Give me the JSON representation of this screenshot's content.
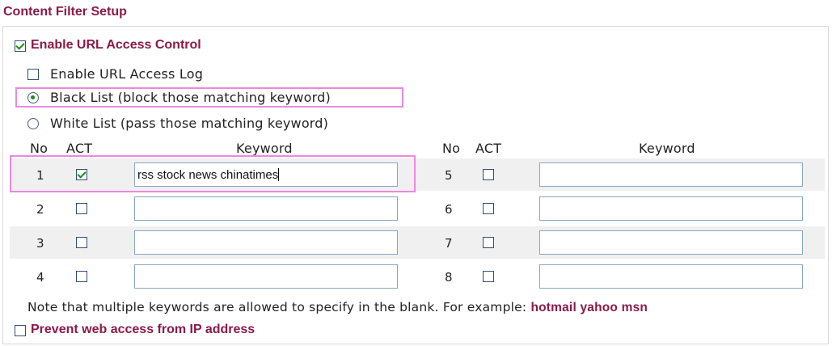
{
  "title": "Content Filter Setup",
  "enable_url_access_control": {
    "label": "Enable URL Access Control",
    "checked": true
  },
  "enable_url_access_log": {
    "label": "Enable URL Access Log",
    "checked": false
  },
  "list_mode": {
    "black": {
      "label": "Black List (block those matching keyword)",
      "selected": true
    },
    "white": {
      "label": "White List (pass those matching keyword)",
      "selected": false
    }
  },
  "headers": {
    "no": "No",
    "act": "ACT",
    "keyword": "Keyword"
  },
  "rows_left": [
    {
      "no": "1",
      "act": true,
      "keyword": "rss stock news chinatimes"
    },
    {
      "no": "2",
      "act": false,
      "keyword": ""
    },
    {
      "no": "3",
      "act": false,
      "keyword": ""
    },
    {
      "no": "4",
      "act": false,
      "keyword": ""
    }
  ],
  "rows_right": [
    {
      "no": "5",
      "act": false,
      "keyword": ""
    },
    {
      "no": "6",
      "act": false,
      "keyword": ""
    },
    {
      "no": "7",
      "act": false,
      "keyword": ""
    },
    {
      "no": "8",
      "act": false,
      "keyword": ""
    }
  ],
  "note": {
    "text": "Note that multiple keywords are allowed to specify in the blank. For example: ",
    "example": "hotmail yahoo msn"
  },
  "prevent_ip": {
    "label": "Prevent web access from IP address",
    "checked": false
  },
  "colors": {
    "accent": "#8b1a47",
    "highlight": "#ee88dd",
    "check": "#1b8a1b"
  }
}
